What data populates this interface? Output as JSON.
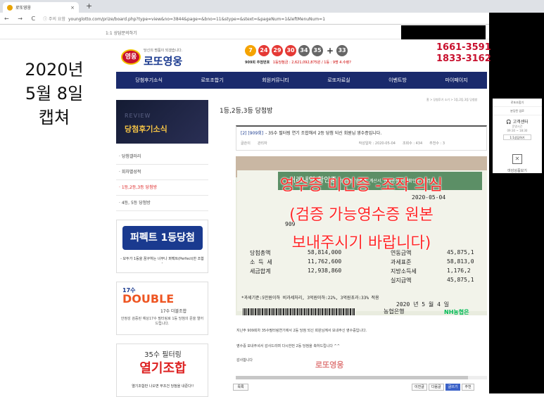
{
  "browser": {
    "tab_title": "로또영웅",
    "tab_close": "×",
    "new_tab": "+",
    "nav_buttons": "← → C",
    "security": "ⓘ 주의 요함",
    "url": "younglotto.com/prize/board.php?type=view&no=3844&page=&bno=11&stype=&stext=&pageNum=1&leftMenuNum=1"
  },
  "topbar": {
    "bookmark": "1:1 상담문의하기"
  },
  "caption": [
    "2020년",
    "5월 8일",
    "캡쳐"
  ],
  "site": {
    "logo_badge": "영웅",
    "slogan": "당신의 명품이 되겠습니다.",
    "logo_name": "로또영웅",
    "balls": [
      {
        "n": "7",
        "color": "#f5a300"
      },
      {
        "n": "24",
        "color": "#e53935"
      },
      {
        "n": "29",
        "color": "#e53935"
      },
      {
        "n": "30",
        "color": "#e53935"
      },
      {
        "n": "34",
        "color": "#666666"
      },
      {
        "n": "35",
        "color": "#666666"
      },
      {
        "n": "33",
        "color": "#666666"
      }
    ],
    "plus": "+",
    "draw_label": "909회 주첨번호",
    "draw_detail": "1등당첨금 : 2,621,092,875원 / 1등 : 9명 4.수령?",
    "phone1": "1661-3591",
    "phone2": "1833-3162",
    "nav": [
      "당첨후기소식",
      "로또조합기",
      "회원커뮤니티",
      "로또자료실",
      "이벤트방",
      "마이페이지"
    ]
  },
  "sidebar": {
    "banner_en": "REVIEW",
    "banner_ko": "당첨후기소식",
    "menu": [
      "당첨갤러리",
      "회차별성적",
      "1등,2등,3등 당첨방",
      "4등, 5등 당첨방"
    ],
    "active_index": 2,
    "promo1_big": "퍼펙트 1등당첨",
    "promo1_small": "- 모두가 1등을 꿈꾸하는 너무나 퍼펙트(Perfect)한 조합 -",
    "promo2_t1": "17수",
    "promo2_t2": "DOUBLE",
    "promo2_t3": "17수 더블조합",
    "promo2_t4": "안정성 검증된 예상17수 필터링로 1등 당첨의 문을 열어드립니다.",
    "promo3_t1": "35수 필터링",
    "promo3_t2": "열기조합",
    "promo3_t3": "열기조합만 나오면 무조건 당첨을 내준다!!"
  },
  "main": {
    "page_title": "1등,2등,3등 당첨방",
    "breadcrumb": "홈 > 당첨후기 소기 > 1등,2등,3등 당첨방",
    "post_no": "[2] [909회]",
    "post_title": "- 35수 필터링 연기 조합해서 2등 당첨 되신 회원님 영수증입니다.",
    "author_label": "글쓴이",
    "author": "관리자",
    "date": "작성일자 : 2020-05-04",
    "views": "조회수 : 434",
    "likes": "추천수 : 3",
    "receipt": {
      "title": "거래내역 확인증",
      "subtitle": "(입금증, 영수증, 계산서, 전자통장 거래확인증 등 겸용)",
      "date": "2020-05-04",
      "round": "909",
      "lines": [
        [
          "당첨총액",
          "58,814,000",
          "연동금액",
          "45,875,1"
        ],
        [
          "소 득 세",
          "11,762,600",
          "과세표준",
          "58,813,0"
        ],
        [
          "세금합계",
          "12,938,860",
          "지방소득세",
          "1,176,2"
        ],
        [
          "",
          "",
          "실지급액",
          "45,875,1"
        ]
      ],
      "tax_note": "*과세기준:5만원이하 비과세처리, 3억원이하:22%, 3억원초과:33% 적용",
      "issue": "2020 년   5 월  4 일",
      "bank": "농협은행",
      "nh": "NH농협은"
    },
    "overlay": [
      "영수증 미인증 -조작 의심",
      "(검증 가능영수증 원본",
      "보내주시기 바랍니다)"
    ],
    "body": [
      "지난주 909회차 35수필터링연기에서 2등 당첨 되신 회원님께서 보내주신 영수증입니다.",
      "영수증 보내주셔서 감사드리며 다시한번 2등 당첨을 축하드립니다 ^^",
      "감사합니다"
    ],
    "watermark": "로또영웅",
    "list_btn": "목록",
    "btns": [
      "이전글",
      "다음글",
      "글쓰기",
      "추천"
    ]
  },
  "right_panel": {
    "items": [
      "로또조합기",
      "분당된 업로"
    ],
    "cs_title": "고객센터",
    "cs_hours": "운영시간",
    "cs_time": "09:30 ~ 18:30",
    "cs_btn": "1:1상담하기",
    "close_label": "마감상품보기"
  }
}
